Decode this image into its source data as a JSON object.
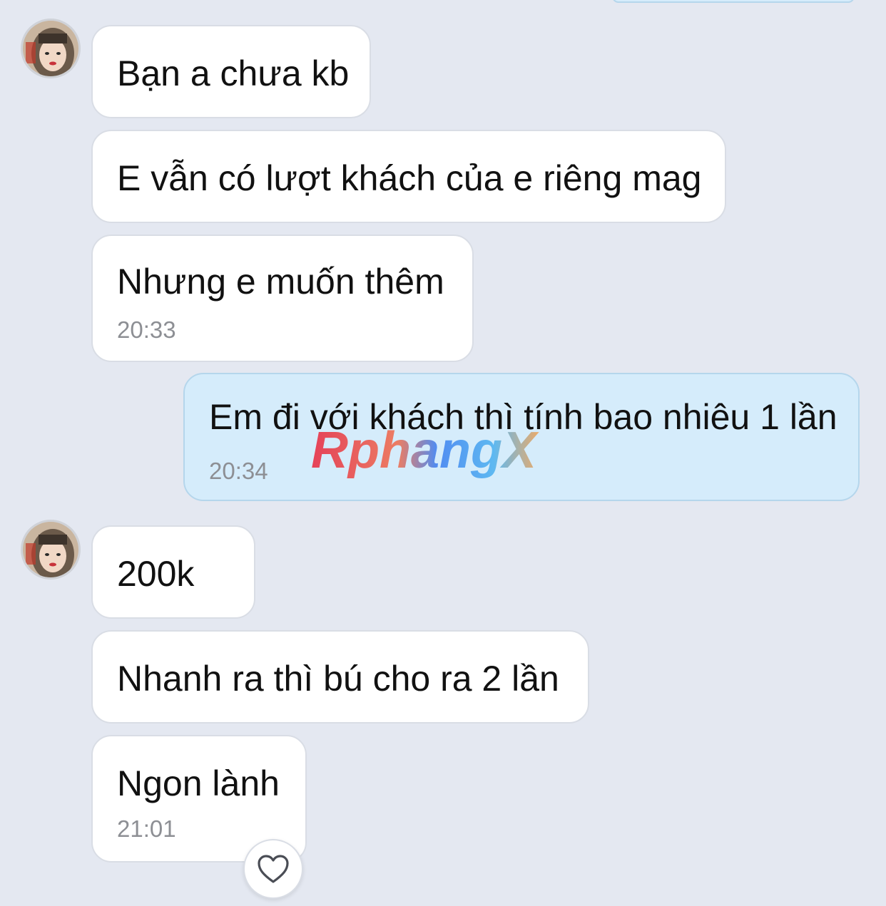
{
  "messages": [
    {
      "text": "Bạn a chưa kb",
      "time": ""
    },
    {
      "text": "E vẫn có lượt khách của e riêng mag",
      "time": ""
    },
    {
      "text": "Nhưng e muốn thêm",
      "time": "20:33"
    },
    {
      "text": "Em đi với khách thì tính bao nhiêu 1 lần",
      "time": "20:34"
    },
    {
      "text": "200k",
      "time": ""
    },
    {
      "text": "Nhanh ra thì bú cho ra 2 lần",
      "time": ""
    },
    {
      "text": "Ngon lành",
      "time": "21:01"
    }
  ],
  "watermark": "RphangX",
  "icons": {
    "avatar": "contact-avatar-icon",
    "reaction": "heart-icon"
  },
  "colors": {
    "background": "#e4e8f1",
    "incoming_bubble": "#ffffff",
    "outgoing_bubble": "#d5ecfb",
    "timestamp": "#8d8f94"
  }
}
